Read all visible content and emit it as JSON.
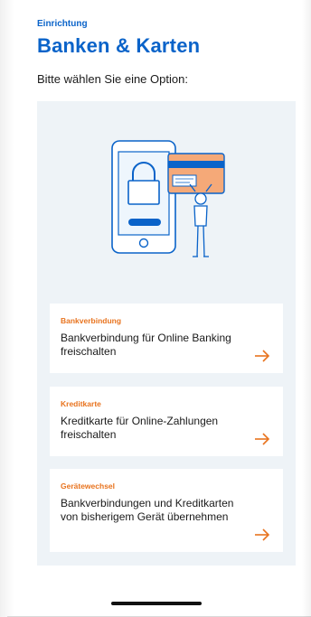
{
  "header": {
    "eyebrow": "Einrichtung",
    "title": "Banken & Karten"
  },
  "prompt": "Bitte wählen Sie eine Option:",
  "colors": {
    "primary_blue": "#0a63c9",
    "accent_orange": "#e8731e",
    "panel_bg": "#eef3f7"
  },
  "illustration": {
    "icon": "phone-lock-credit-card-illustration"
  },
  "options": [
    {
      "category": "Bankverbindung",
      "description": "Bankverbindung für Online Banking freischalten",
      "icon": "arrow-right-icon"
    },
    {
      "category": "Kreditkarte",
      "description": "Kreditkarte für Online-Zahlungen freischalten",
      "icon": "arrow-right-icon"
    },
    {
      "category": "Gerätewechsel",
      "description": "Bankverbindungen und Kreditkarten von bisherigem Gerät übernehmen",
      "icon": "arrow-right-icon"
    }
  ]
}
